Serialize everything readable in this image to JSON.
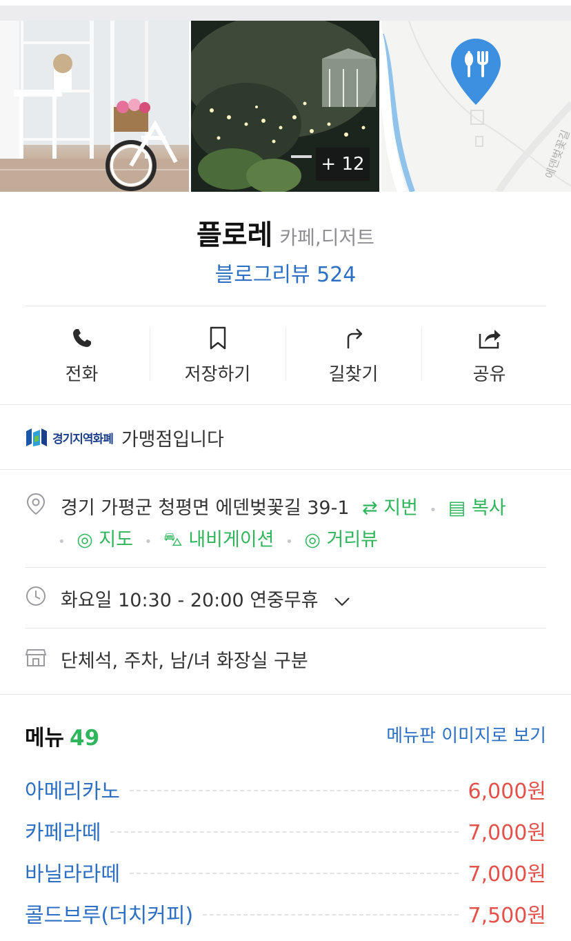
{
  "photos": {
    "more_count": "+ 12"
  },
  "place": {
    "name": "플로레",
    "category": "카페,디저트",
    "blog_review": "블로그리뷰 524"
  },
  "actions": [
    {
      "label": "전화",
      "icon": "phone-icon"
    },
    {
      "label": "저장하기",
      "icon": "bookmark-icon"
    },
    {
      "label": "길찾기",
      "icon": "directions-icon"
    },
    {
      "label": "공유",
      "icon": "share-icon"
    }
  ],
  "partner": {
    "logo_text": "경기지역화폐",
    "text": "가맹점입니다"
  },
  "address": {
    "text": "경기 가평군 청평면 에덴벚꽃길 39-1",
    "jibun": "지번",
    "copy": "복사",
    "map": "지도",
    "navigation": "내비게이션",
    "street_view": "거리뷰"
  },
  "hours": {
    "text": "화요일 10:30 - 20:00 연중무휴"
  },
  "facilities": {
    "text": "단체석, 주차, 남/녀 화장실 구분"
  },
  "menu": {
    "title": "메뉴",
    "count": "49",
    "board_link": "메뉴판 이미지로 보기",
    "items": [
      {
        "name": "아메리카노",
        "price": "6,000원"
      },
      {
        "name": "카페라떼",
        "price": "7,000원"
      },
      {
        "name": "바닐라라떼",
        "price": "7,000원"
      },
      {
        "name": "콜드브루(더치커피)",
        "price": "7,500원"
      }
    ]
  },
  "colors": {
    "link_blue": "#2d6fc2",
    "green": "#2fb55b",
    "price_red": "#e4504a",
    "map_pin": "#3d8fe0"
  }
}
